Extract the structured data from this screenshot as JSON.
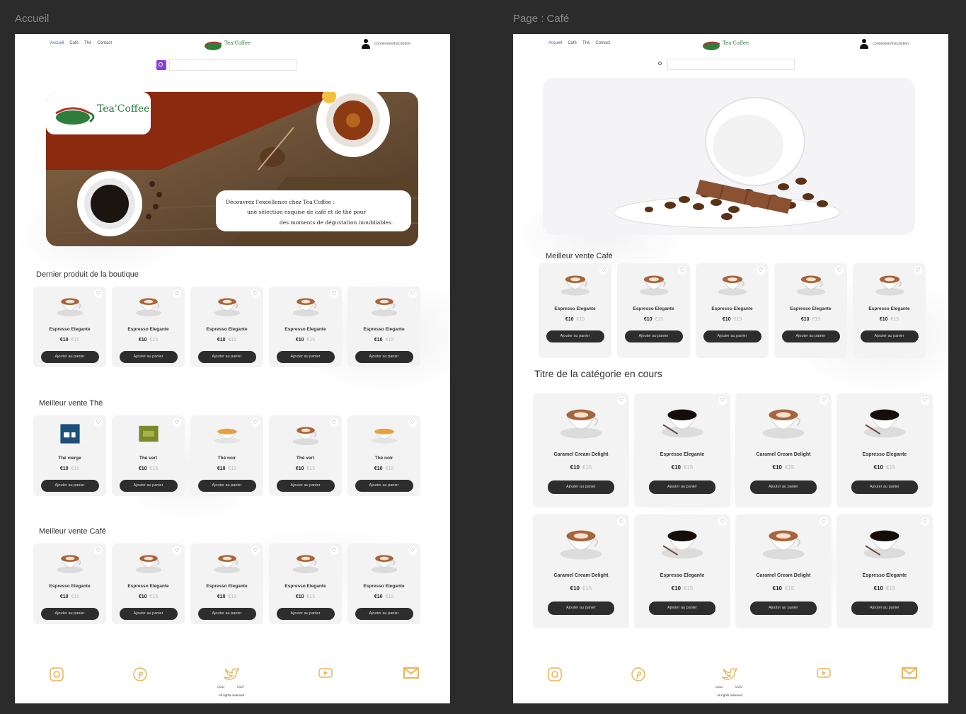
{
  "frames": [
    {
      "label": "Accueil"
    },
    {
      "label": "Page : Café"
    }
  ],
  "header": {
    "nav": [
      "Accueil",
      "Café",
      "Thé",
      "Contact"
    ],
    "account": "connexion/inscription",
    "logo_text": "Tea'Coffee"
  },
  "pageA": {
    "hero_lines": [
      "Découvrez l'excellence chez Tea'Coffee :",
      "une sélection exquise de café et de thé pour",
      "des moments de dégustation inoubliables."
    ],
    "hero_logo": "Tea'Coffee",
    "sections": [
      {
        "title": "Dernier produit de la boutique",
        "products": [
          {
            "name": "Espresso Elegante",
            "price": "€10",
            "old": "€15",
            "btn": "Ajouter au panier",
            "img": "latte"
          },
          {
            "name": "Espresso Elegante",
            "price": "€10",
            "old": "€15",
            "btn": "Ajouter au panier",
            "img": "latte"
          },
          {
            "name": "Espresso Elegante",
            "price": "€10",
            "old": "€15",
            "btn": "Ajouter au panier",
            "img": "latte"
          },
          {
            "name": "Espresso Elegante",
            "price": "€10",
            "old": "€15",
            "btn": "Ajouter au panier",
            "img": "latte"
          },
          {
            "name": "Espresso Elegante",
            "price": "€10",
            "old": "€15",
            "btn": "Ajouter au panier",
            "img": "latte"
          }
        ]
      },
      {
        "title": "Meilleur vente Thé",
        "products": [
          {
            "name": "Thé vierge",
            "price": "€10",
            "old": "€15",
            "btn": "Ajouter au panier",
            "img": "box"
          },
          {
            "name": "Thé vert",
            "price": "€10",
            "old": "€15",
            "btn": "Ajouter au panier",
            "img": "greenbox"
          },
          {
            "name": "Thé noir",
            "price": "€10",
            "old": "€15",
            "btn": "Ajouter au panier",
            "img": "tea"
          },
          {
            "name": "Thé vert",
            "price": "€10",
            "old": "€15",
            "btn": "Ajouter au panier",
            "img": "latte"
          },
          {
            "name": "Thé noir",
            "price": "€10",
            "old": "€15",
            "btn": "Ajouter au panier",
            "img": "tea"
          }
        ]
      },
      {
        "title": "Meilleur vente Café",
        "products": [
          {
            "name": "Espresso Elegante",
            "price": "€10",
            "old": "€15",
            "btn": "Ajouter au panier",
            "img": "latte"
          },
          {
            "name": "Espresso Elegante",
            "price": "€10",
            "old": "€15",
            "btn": "Ajouter au panier",
            "img": "latte"
          },
          {
            "name": "Espresso Elegante",
            "price": "€10",
            "old": "€15",
            "btn": "Ajouter au panier",
            "img": "latte"
          },
          {
            "name": "Espresso Elegante",
            "price": "€10",
            "old": "€15",
            "btn": "Ajouter au panier",
            "img": "latte"
          },
          {
            "name": "Espresso Elegante",
            "price": "€10",
            "old": "€15",
            "btn": "Ajouter au panier",
            "img": "latte"
          }
        ]
      }
    ]
  },
  "pageB": {
    "best_title": "Meilleur vente Café",
    "best": [
      {
        "name": "Espresso Elegante",
        "price": "€10",
        "old": "€15",
        "btn": "Ajouter au panier",
        "img": "latte"
      },
      {
        "name": "Espresso Elegante",
        "price": "€10",
        "old": "€15",
        "btn": "Ajouter au panier",
        "img": "latte"
      },
      {
        "name": "Espresso Elegante",
        "price": "€10",
        "old": "€15",
        "btn": "Ajouter au panier",
        "img": "latte"
      },
      {
        "name": "Espresso Elegante",
        "price": "€10",
        "old": "€15",
        "btn": "Ajouter au panier",
        "img": "latte"
      },
      {
        "name": "Espresso Elegante",
        "price": "€10",
        "old": "€15",
        "btn": "Ajouter au panier",
        "img": "latte"
      }
    ],
    "category_title": "Titre de la catégorie en cours",
    "category": [
      {
        "name": "Caramel Cream Delight",
        "price": "€10",
        "old": "€15",
        "btn": "Ajouter au panier",
        "img": "latte"
      },
      {
        "name": "Espresso Elegante",
        "price": "€10",
        "old": "€15",
        "btn": "Ajouter au panier",
        "img": "black"
      },
      {
        "name": "Caramel Cream Delight",
        "price": "€10",
        "old": "€15",
        "btn": "Ajouter au panier",
        "img": "latte"
      },
      {
        "name": "Espresso Elegante",
        "price": "€10",
        "old": "€15",
        "btn": "Ajouter au panier",
        "img": "black"
      },
      {
        "name": "Caramel Cream Delight",
        "price": "€10",
        "old": "€15",
        "btn": "Ajouter au panier",
        "img": "latte"
      },
      {
        "name": "Espresso Elegante",
        "price": "€10",
        "old": "€15",
        "btn": "Ajouter au panier",
        "img": "black"
      },
      {
        "name": "Caramel Cream Delight",
        "price": "€10",
        "old": "€15",
        "btn": "Ajouter au panier",
        "img": "latte"
      },
      {
        "name": "Espresso Elegante",
        "price": "€10",
        "old": "€15",
        "btn": "Ajouter au panier",
        "img": "black"
      }
    ]
  },
  "footer": {
    "icons": [
      "instagram-icon",
      "pinterest-icon",
      "twitter-icon",
      "youtube-icon",
      "mail-icon"
    ],
    "captions": [
      "CGU",
      "CGV"
    ],
    "rights": "All rights reserved",
    "icon_color": "#e8b45a"
  }
}
